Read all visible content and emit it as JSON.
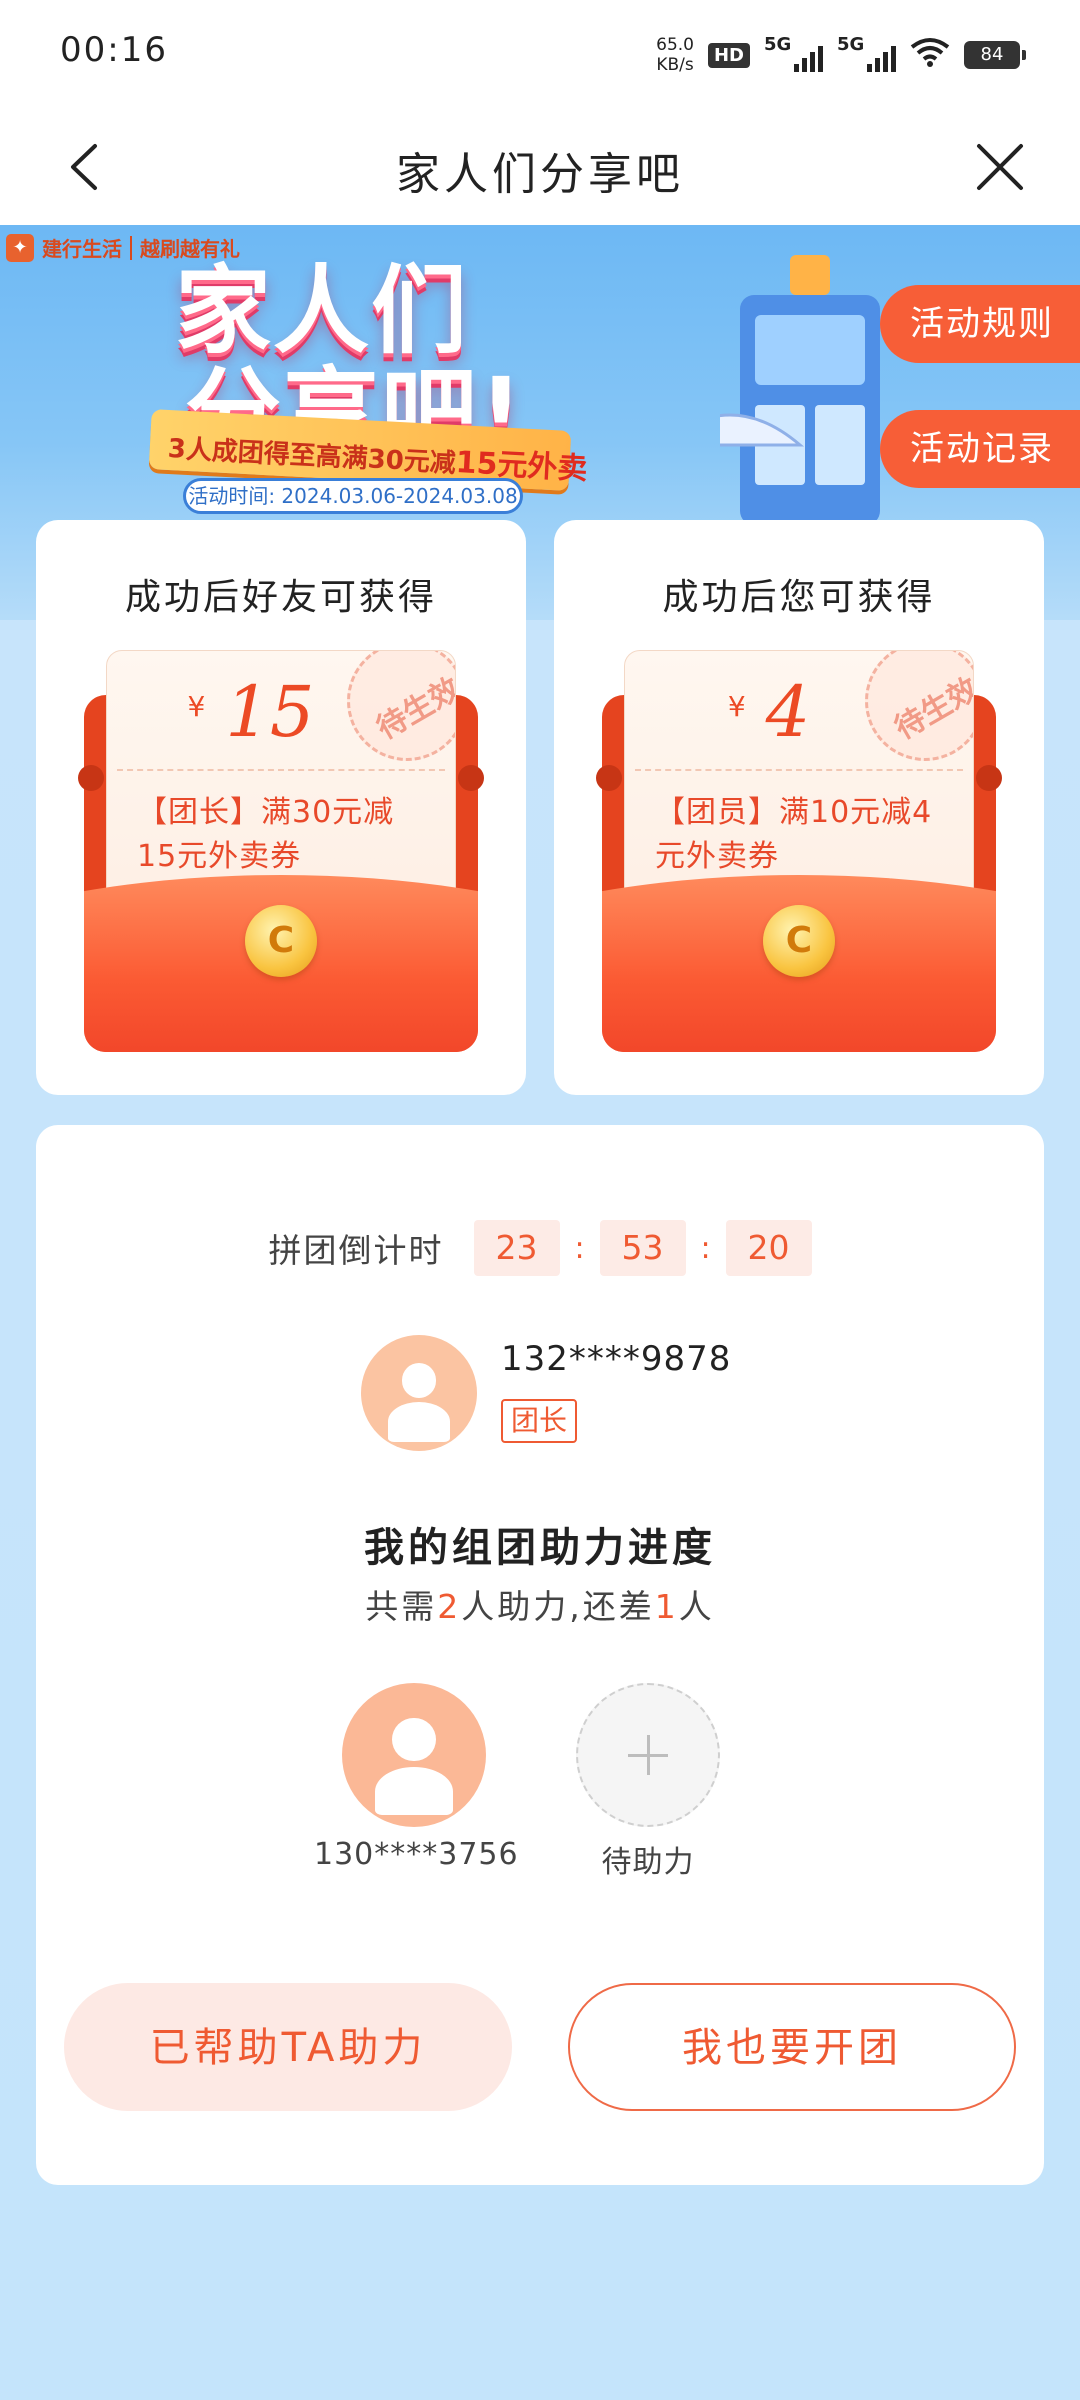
{
  "status_bar": {
    "time": "00:16",
    "net_speed_value": "65.0",
    "net_speed_unit": "KB/s",
    "hd": "HD",
    "signal1": "5G",
    "signal2": "5G",
    "battery": "84"
  },
  "nav": {
    "title": "家人们分享吧",
    "back_icon": "chevron-left-icon",
    "close_icon": "close-icon"
  },
  "banner": {
    "brand": "建行生活",
    "brand_tag": "越刷越有礼",
    "title_line1": "家人们",
    "title_line2": "分享吧!",
    "ribbon_prefix": "3人",
    "ribbon_middle": "成团得至高满30元减",
    "ribbon_highlight": "15元外卖",
    "activity_time": "活动时间: 2024.03.06-2024.03.08",
    "rules_button": "活动规则",
    "records_button": "活动记录"
  },
  "rewards": [
    {
      "title": "成功后好友可获得",
      "currency": "¥",
      "amount": "15",
      "stamp": "待生效",
      "description": "【团长】满30元减15元外卖券"
    },
    {
      "title": "成功后您可获得",
      "currency": "¥",
      "amount": "4",
      "stamp": "待生效",
      "description": "【团员】满10元减4元外卖券"
    }
  ],
  "group": {
    "countdown_label": "拼团倒计时",
    "hours": "23",
    "minutes": "53",
    "seconds": "20",
    "separator": ":",
    "leader_phone": "132****9878",
    "leader_badge": "团长",
    "progress_title": "我的组团助力进度",
    "progress_sub_1": "共需",
    "progress_needed": "2",
    "progress_sub_2": "人助力,还差",
    "progress_remaining": "1",
    "progress_sub_3": "人",
    "members": [
      {
        "name": "130****3756"
      },
      {
        "name": "待助力"
      }
    ],
    "helped_button": "已帮助TA助力",
    "open_button": "我也要开团"
  }
}
